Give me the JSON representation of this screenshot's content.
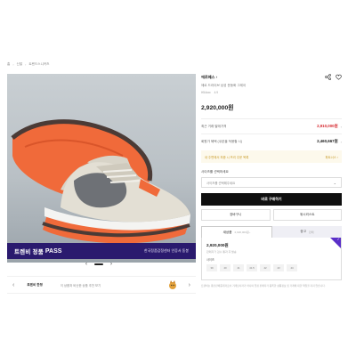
{
  "breadcrumb": [
    "홈",
    "신발",
    "트렌드스니커즈"
  ],
  "promo": {
    "title": "트렌비 정품",
    "pass": "PASS",
    "desc": "한국정품감정센터 인증서 동봉"
  },
  "carousel": {
    "prev": "‹",
    "next": "›"
  },
  "related": {
    "label": "트렌비 한정",
    "info": "이 상품과 비슷한 상품 추천 보기"
  },
  "product": {
    "brand": "에르메스",
    "brand_chevron": "›",
    "name": "에르 드라이브 남성 운동화 그레이",
    "meta": [
      "H54xxx",
      "4.9"
    ],
    "price": "2,920,000원"
  },
  "price_rows": [
    {
      "label": "최근 거래 발매가격",
      "value": "2,910,000원",
      "red": true
    },
    {
      "label": "회원가 혜택 (쿠폰을 적용할 시)",
      "value": "2,460,667원",
      "red": false
    }
  ],
  "notice": {
    "left": "내 주변에서 최종 시 프리 주문 목록",
    "right": "파트너스 ›"
  },
  "option": {
    "label": "사이즈를 선택하세요",
    "placeholder": "사이즈를 선택해주세요"
  },
  "buttons": {
    "buy": "바로 구매하기",
    "secondary": [
      "장바구니",
      "위시리스트"
    ]
  },
  "tabs": [
    {
      "label": "새상품",
      "sub": "2,920,000원~"
    },
    {
      "label": "중고",
      "sub": "판매"
    }
  ],
  "offer": {
    "price": "2,920,000원",
    "sub": "판매자가 검수 통과 후 발송",
    "size_label": "사이즈",
    "sizes": [
      "39",
      "40",
      "41",
      "41.5",
      "42",
      "43",
      "44"
    ]
  },
  "footnote": "트렌비는 통신판매중개자로서 거래당사자가 아니며 입점 판매자가 등록한 상품정보 및 거래에 대한 책임을 지지 않습니다.",
  "colors": {
    "accent": "#5a2fc8",
    "banner": "#2a1a6e",
    "price_red": "#d6282f",
    "sole": "#f06a3a"
  },
  "icons": [
    "share-icon",
    "heart-icon",
    "chevron-left-icon",
    "chevron-right-icon",
    "caret-down-icon"
  ]
}
